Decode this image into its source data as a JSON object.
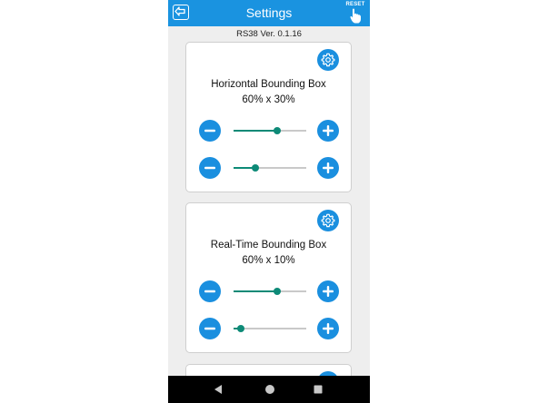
{
  "app": {
    "title": "Settings",
    "reset_label": "RESET",
    "version": "RS38 Ver. 0.1.16"
  },
  "colors": {
    "appbar": "#1a93e0",
    "button": "#1a8fdf",
    "slider_accent": "#0d8a77",
    "background": "#eeeeee"
  },
  "icons": {
    "back": "back-arrow-icon",
    "reset": "hand-pointer-icon",
    "settings": "gear-icon",
    "decrease": "minus-icon",
    "increase": "plus-icon"
  },
  "cards": [
    {
      "title": "Horizontal Bounding Box",
      "value": "60% x 30%",
      "sliders": [
        {
          "percent": 60
        },
        {
          "percent": 30
        }
      ]
    },
    {
      "title": "Real-Time Bounding Box",
      "value": "60% x 10%",
      "sliders": [
        {
          "percent": 60
        },
        {
          "percent": 10
        }
      ]
    }
  ]
}
